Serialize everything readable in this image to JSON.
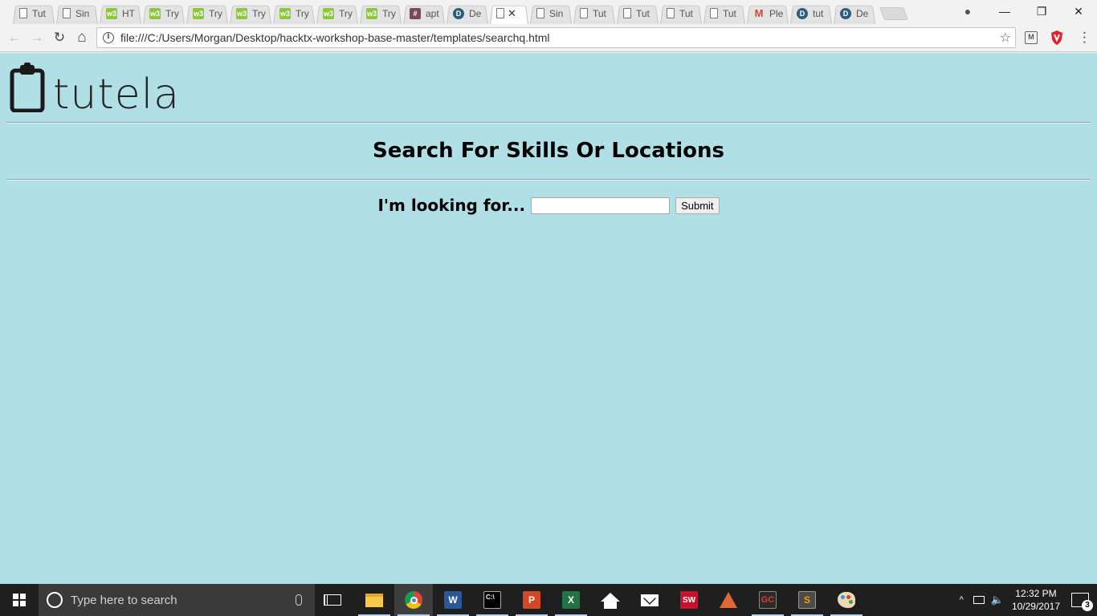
{
  "browser": {
    "tabs": [
      {
        "title": "Tut",
        "favicon": "doc"
      },
      {
        "title": "Sin",
        "favicon": "doc"
      },
      {
        "title": "HT",
        "favicon": "w3"
      },
      {
        "title": "Try",
        "favicon": "w3"
      },
      {
        "title": "Try",
        "favicon": "w3"
      },
      {
        "title": "Try",
        "favicon": "w3"
      },
      {
        "title": "Try",
        "favicon": "w3"
      },
      {
        "title": "Try",
        "favicon": "w3"
      },
      {
        "title": "Try",
        "favicon": "w3"
      },
      {
        "title": "apt",
        "favicon": "hash"
      },
      {
        "title": "De",
        "favicon": "d"
      },
      {
        "title": "",
        "favicon": "doc",
        "active": true
      },
      {
        "title": "Sin",
        "favicon": "doc"
      },
      {
        "title": "Tut",
        "favicon": "doc"
      },
      {
        "title": "Tut",
        "favicon": "doc"
      },
      {
        "title": "Tut",
        "favicon": "doc"
      },
      {
        "title": "Tut",
        "favicon": "doc"
      },
      {
        "title": "Ple",
        "favicon": "m"
      },
      {
        "title": "tut",
        "favicon": "d"
      },
      {
        "title": "De",
        "favicon": "d"
      }
    ],
    "favicon_text": {
      "w3": "w3",
      "hash": "#",
      "d": "D",
      "m": "M"
    },
    "tab_close_glyph": "✕",
    "url": "file:///C:/Users/Morgan/Desktop/hacktx-workshop-base-master/templates/searchq.html",
    "glyphs": {
      "back": "←",
      "forward": "→",
      "reload": "↻",
      "home": "⌂",
      "info": "i",
      "star": "☆",
      "menu": "⋮",
      "profile": "●",
      "minimize": "—",
      "restore": "❐",
      "close": "✕",
      "ext": "M"
    }
  },
  "page": {
    "logo_text": "tutela",
    "heading": "Search For Skills Or Locations",
    "search_label": "I'm looking for...",
    "search_value": "",
    "submit_label": "Submit",
    "background_color": "#b0dfe6"
  },
  "taskbar": {
    "search_placeholder": "Type here to search",
    "app_labels": {
      "word": "W",
      "cmd": "C:\\",
      "ppt": "P",
      "excel": "X",
      "sw": "SW",
      "gc": "GC",
      "sublime": "S"
    },
    "tray": {
      "chevron": "^",
      "volume": "🔈"
    },
    "time": "12:32 PM",
    "date": "10/29/2017",
    "notification_count": "3"
  }
}
